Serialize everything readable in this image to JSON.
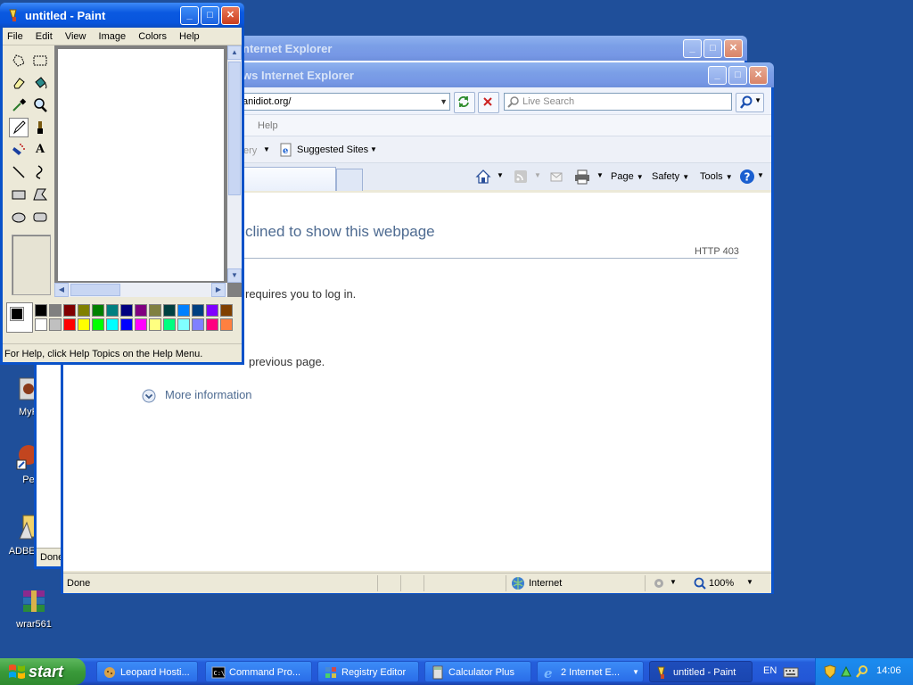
{
  "desktop": {
    "icons": [
      {
        "label": "MyP"
      },
      {
        "label": "Pe"
      },
      {
        "label": "ADBEFU"
      },
      {
        "label": "wrar561"
      }
    ]
  },
  "ie_back": {
    "title": "nternet Explorer",
    "status": "Done"
  },
  "ie_front": {
    "title": "ws Internet Explorer",
    "address": "anidiot.org/",
    "search_placeholder": "Live Search",
    "menu_help": "Help",
    "fav_partial": "ery",
    "suggested_sites": "Suggested Sites",
    "commands": {
      "page": "Page",
      "safety": "Safety",
      "tools": "Tools"
    },
    "content": {
      "heading": "clined to show this webpage",
      "http_code": "HTTP 403",
      "line1": "requires you to log in.",
      "line2": "previous page.",
      "more_info": "More information"
    },
    "status": {
      "text": "Done",
      "zone": "Internet",
      "zoom": "100%"
    }
  },
  "paint": {
    "title": "untitled - Paint",
    "menu": [
      "File",
      "Edit",
      "View",
      "Image",
      "Colors",
      "Help"
    ],
    "status": "For Help, click Help Topics on the Help Menu.",
    "palette_top": [
      "#000000",
      "#808080",
      "#800000",
      "#808000",
      "#008000",
      "#008080",
      "#000080",
      "#800080",
      "#808040",
      "#004040",
      "#0080ff",
      "#004080",
      "#8000ff",
      "#804000"
    ],
    "palette_bottom": [
      "#ffffff",
      "#c0c0c0",
      "#ff0000",
      "#ffff00",
      "#00ff00",
      "#00ffff",
      "#0000ff",
      "#ff00ff",
      "#ffff80",
      "#00ff80",
      "#80ffff",
      "#8080ff",
      "#ff0080",
      "#ff8040"
    ]
  },
  "taskbar": {
    "start": "start",
    "tasks": [
      {
        "label": "Leopard Hosti..."
      },
      {
        "label": "Command Pro..."
      },
      {
        "label": "Registry Editor"
      },
      {
        "label": "Calculator Plus"
      },
      {
        "label": "2 Internet E..."
      },
      {
        "label": "untitled - Paint"
      }
    ],
    "lang": "EN",
    "clock": "14:06"
  }
}
